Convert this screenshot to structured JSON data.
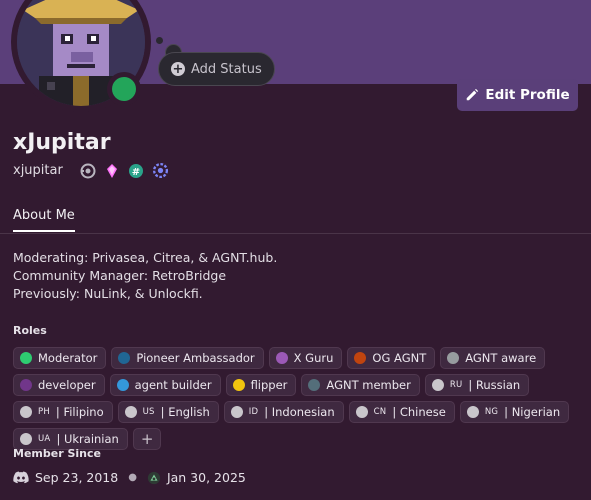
{
  "header": {
    "add_status_label": "Add Status",
    "edit_profile_label": "Edit Profile",
    "banner_color": "#5b3f7a",
    "status_color": "#23a55a"
  },
  "profile": {
    "display_name": "xJupitar",
    "username": "xjupitar",
    "badges": [
      "boost-icon",
      "nitro-gem-icon",
      "hashtag-badge-icon",
      "hypesquad-icon"
    ]
  },
  "tabs": [
    {
      "label": "About Me",
      "active": true
    }
  ],
  "bio": {
    "lines": [
      "Moderating: Privasea, Citrea, & AGNT.hub.",
      "Community Manager: RetroBridge",
      "Previously: NuLink, & Unlockfi."
    ]
  },
  "roles": {
    "title": "Roles",
    "items": [
      {
        "label": "Moderator",
        "color": "#2ecc71"
      },
      {
        "label": "Pioneer Ambassador",
        "color": "#206694"
      },
      {
        "label": "X Guru",
        "color": "#9b59b6"
      },
      {
        "label": "OG AGNT",
        "color": "#c0440f"
      },
      {
        "label": "AGNT aware",
        "color": "#979c9f"
      },
      {
        "label": "developer",
        "color": "#71368a"
      },
      {
        "label": "agent builder",
        "color": "#3498db"
      },
      {
        "label": "flipper",
        "color": "#f1c40f"
      },
      {
        "label": "AGNT member",
        "color": "#546e7a"
      },
      {
        "prefix": "RU",
        "label": "| Russian",
        "color": "#c9c6cb"
      },
      {
        "prefix": "PH",
        "label": "| Filipino",
        "color": "#c9c6cb"
      },
      {
        "prefix": "US",
        "label": "| English",
        "color": "#c9c6cb"
      },
      {
        "prefix": "ID",
        "label": "| Indonesian",
        "color": "#c9c6cb"
      },
      {
        "prefix": "CN",
        "label": "| Chinese",
        "color": "#c9c6cb"
      },
      {
        "prefix": "NG",
        "label": "| Nigerian",
        "color": "#c9c6cb"
      },
      {
        "prefix": "UA",
        "label": "| Ukrainian",
        "color": "#c9c6cb"
      }
    ],
    "add_label": "+"
  },
  "member_since": {
    "title": "Member Since",
    "discord_date": "Sep 23, 2018",
    "server_date": "Jan 30, 2025"
  }
}
